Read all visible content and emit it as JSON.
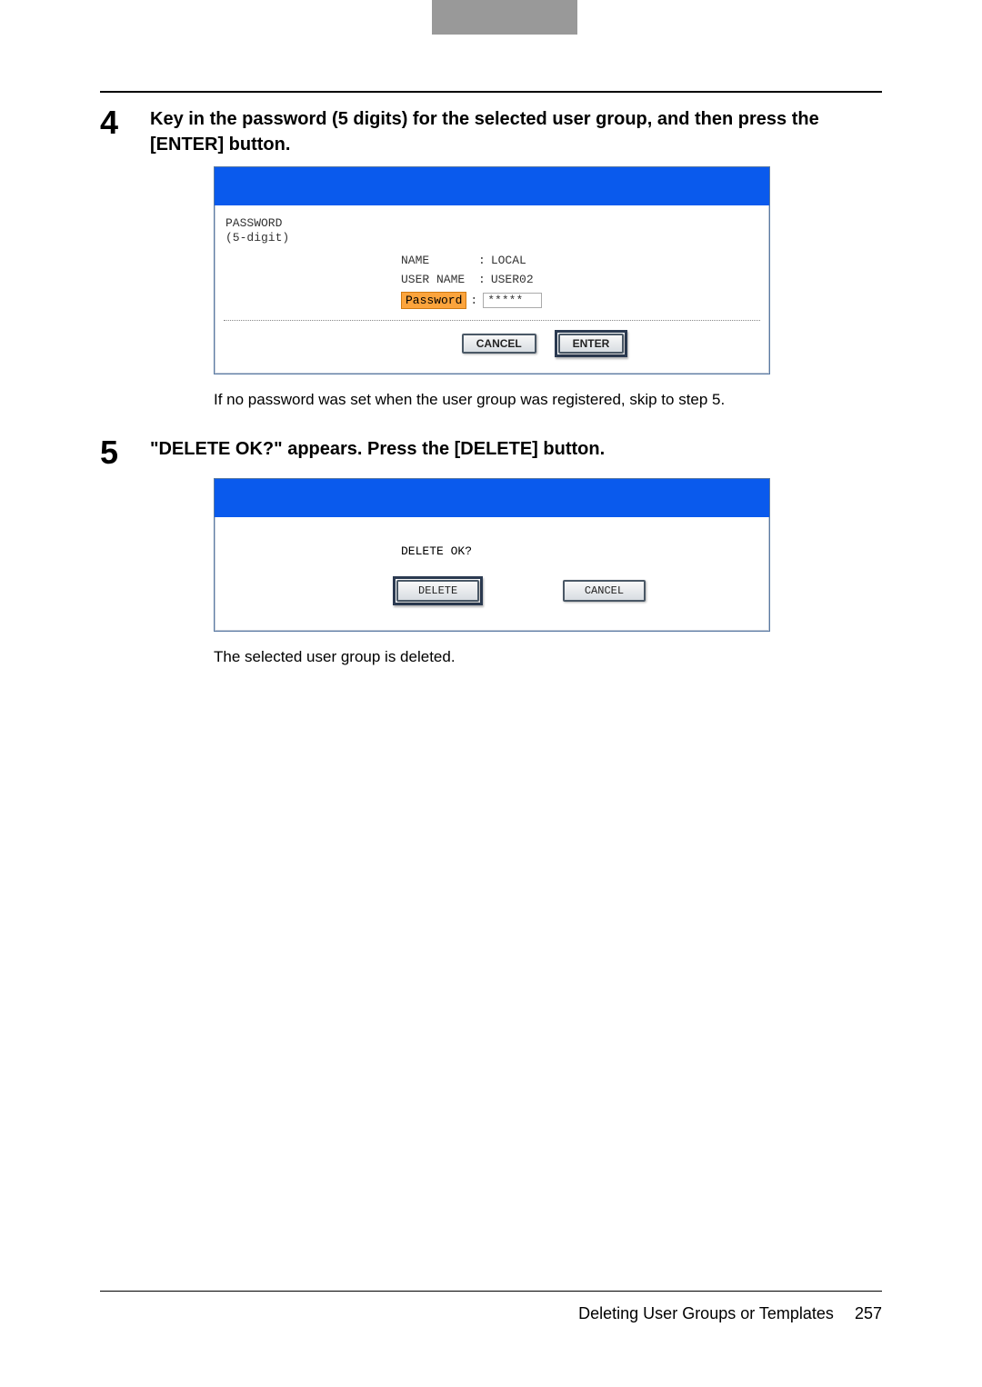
{
  "step4": {
    "number": "4",
    "title": "Key in the password (5 digits) for the selected user group, and then press the [ENTER] button.",
    "screen": {
      "prompt_line1": "PASSWORD",
      "prompt_line2": "(5-digit)",
      "name_label": "NAME",
      "name_value": "LOCAL",
      "username_label": "USER NAME",
      "username_value": "USER02",
      "password_label": "Password",
      "password_value": "*****",
      "cancel": "CANCEL",
      "enter": "ENTER"
    },
    "note": "If no password was set when the user group was registered, skip to step 5."
  },
  "step5": {
    "number": "5",
    "title": "\"DELETE OK?\" appears. Press the [DELETE] button.",
    "screen": {
      "prompt": "DELETE OK?",
      "delete": "DELETE",
      "cancel": "CANCEL"
    },
    "note": "The selected user group is deleted."
  },
  "footer": {
    "section": "Deleting User Groups or Templates",
    "page": "257"
  }
}
